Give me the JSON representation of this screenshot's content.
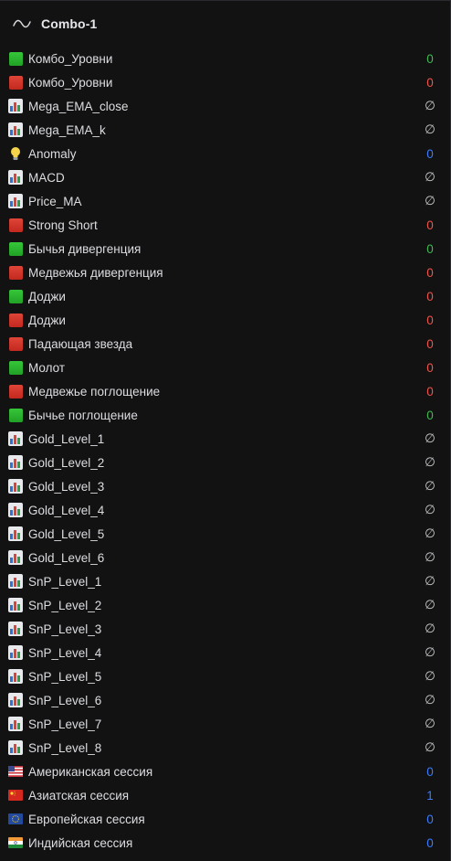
{
  "header": {
    "title": "Combo-1",
    "icon": "wave-icon"
  },
  "rows": [
    {
      "icon": "green-square-icon",
      "label": "Комбо_Уровни",
      "value": "0",
      "value_color": "#3fb950"
    },
    {
      "icon": "red-square-icon",
      "label": "Комбо_Уровни",
      "value": "0",
      "value_color": "#f0524a"
    },
    {
      "icon": "bar-chart-icon",
      "label": "Mega_EMA_close",
      "value": "∅",
      "value_color": "#c9cacd"
    },
    {
      "icon": "bar-chart-icon",
      "label": "Mega_EMA_k",
      "value": "∅",
      "value_color": "#c9cacd"
    },
    {
      "icon": "light-bulb-icon",
      "label": "Anomaly",
      "value": "0",
      "value_color": "#3a7bff"
    },
    {
      "icon": "bar-chart-icon",
      "label": "MACD",
      "value": "∅",
      "value_color": "#c9cacd"
    },
    {
      "icon": "bar-chart-icon",
      "label": "Price_MA",
      "value": "∅",
      "value_color": "#c9cacd"
    },
    {
      "icon": "red-square-icon",
      "label": "Strong Short",
      "value": "0",
      "value_color": "#f0524a"
    },
    {
      "icon": "green-square-icon",
      "label": "Бычья дивергенция",
      "value": "0",
      "value_color": "#3fb950"
    },
    {
      "icon": "red-square-icon",
      "label": "Медвежья дивергенция",
      "value": "0",
      "value_color": "#f0524a"
    },
    {
      "icon": "green-square-icon",
      "label": "Доджи",
      "value": "0",
      "value_color": "#f0524a"
    },
    {
      "icon": "red-square-icon",
      "label": "Доджи",
      "value": "0",
      "value_color": "#f0524a"
    },
    {
      "icon": "red-square-icon",
      "label": "Падающая звезда",
      "value": "0",
      "value_color": "#f0524a"
    },
    {
      "icon": "green-square-icon",
      "label": "Молот",
      "value": "0",
      "value_color": "#f0524a"
    },
    {
      "icon": "red-square-icon",
      "label": "Медвежье поглощение",
      "value": "0",
      "value_color": "#f0524a"
    },
    {
      "icon": "green-square-icon",
      "label": "Бычье поглощение",
      "value": "0",
      "value_color": "#3fb950"
    },
    {
      "icon": "bar-chart-icon",
      "label": "Gold_Level_1",
      "value": "∅",
      "value_color": "#c9cacd"
    },
    {
      "icon": "bar-chart-icon",
      "label": "Gold_Level_2",
      "value": "∅",
      "value_color": "#c9cacd"
    },
    {
      "icon": "bar-chart-icon",
      "label": "Gold_Level_3",
      "value": "∅",
      "value_color": "#c9cacd"
    },
    {
      "icon": "bar-chart-icon",
      "label": "Gold_Level_4",
      "value": "∅",
      "value_color": "#c9cacd"
    },
    {
      "icon": "bar-chart-icon",
      "label": "Gold_Level_5",
      "value": "∅",
      "value_color": "#c9cacd"
    },
    {
      "icon": "bar-chart-icon",
      "label": "Gold_Level_6",
      "value": "∅",
      "value_color": "#c9cacd"
    },
    {
      "icon": "bar-chart-icon",
      "label": "SnP_Level_1",
      "value": "∅",
      "value_color": "#c9cacd"
    },
    {
      "icon": "bar-chart-icon",
      "label": "SnP_Level_2",
      "value": "∅",
      "value_color": "#c9cacd"
    },
    {
      "icon": "bar-chart-icon",
      "label": "SnP_Level_3",
      "value": "∅",
      "value_color": "#c9cacd"
    },
    {
      "icon": "bar-chart-icon",
      "label": "SnP_Level_4",
      "value": "∅",
      "value_color": "#c9cacd"
    },
    {
      "icon": "bar-chart-icon",
      "label": "SnP_Level_5",
      "value": "∅",
      "value_color": "#c9cacd"
    },
    {
      "icon": "bar-chart-icon",
      "label": "SnP_Level_6",
      "value": "∅",
      "value_color": "#c9cacd"
    },
    {
      "icon": "bar-chart-icon",
      "label": "SnP_Level_7",
      "value": "∅",
      "value_color": "#c9cacd"
    },
    {
      "icon": "bar-chart-icon",
      "label": "SnP_Level_8",
      "value": "∅",
      "value_color": "#c9cacd"
    },
    {
      "icon": "us-flag-icon",
      "label": "Американская сессия",
      "value": "0",
      "value_color": "#3a7bff"
    },
    {
      "icon": "china-flag-icon",
      "label": "Азиатская сессия",
      "value": "1",
      "value_color": "#3a7bff"
    },
    {
      "icon": "eu-flag-icon",
      "label": "Европейская сессия",
      "value": "0",
      "value_color": "#3a7bff"
    },
    {
      "icon": "india-flag-icon",
      "label": "Индийская сессия",
      "value": "0",
      "value_color": "#3a7bff"
    }
  ]
}
